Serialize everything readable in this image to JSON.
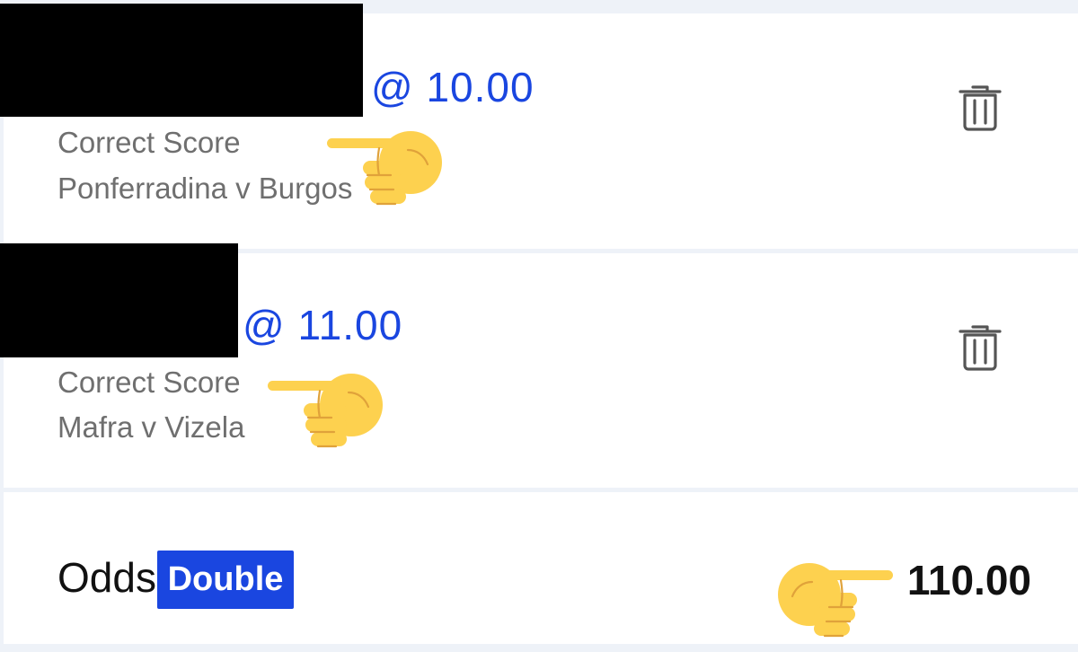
{
  "bets": [
    {
      "odds": "@ 10.00",
      "market": "Correct Score",
      "event": "Ponferradina v Burgos",
      "icon": "trash-icon"
    },
    {
      "odds": "@ 11.00",
      "market": "Correct Score",
      "event": "Mafra v Vizela",
      "icon": "trash-icon"
    }
  ],
  "summary": {
    "label": "Odds",
    "badge": "Double",
    "total": "110.00"
  },
  "colors": {
    "accent": "#1a46e0",
    "muted_text": "#6f6f6f",
    "background": "#eef2f8",
    "redaction": "#000000",
    "emoji_yellow": "#fdd14f"
  },
  "annotations": [
    "pointing-hand-emoji",
    "pointing-hand-emoji",
    "pointing-hand-emoji"
  ]
}
